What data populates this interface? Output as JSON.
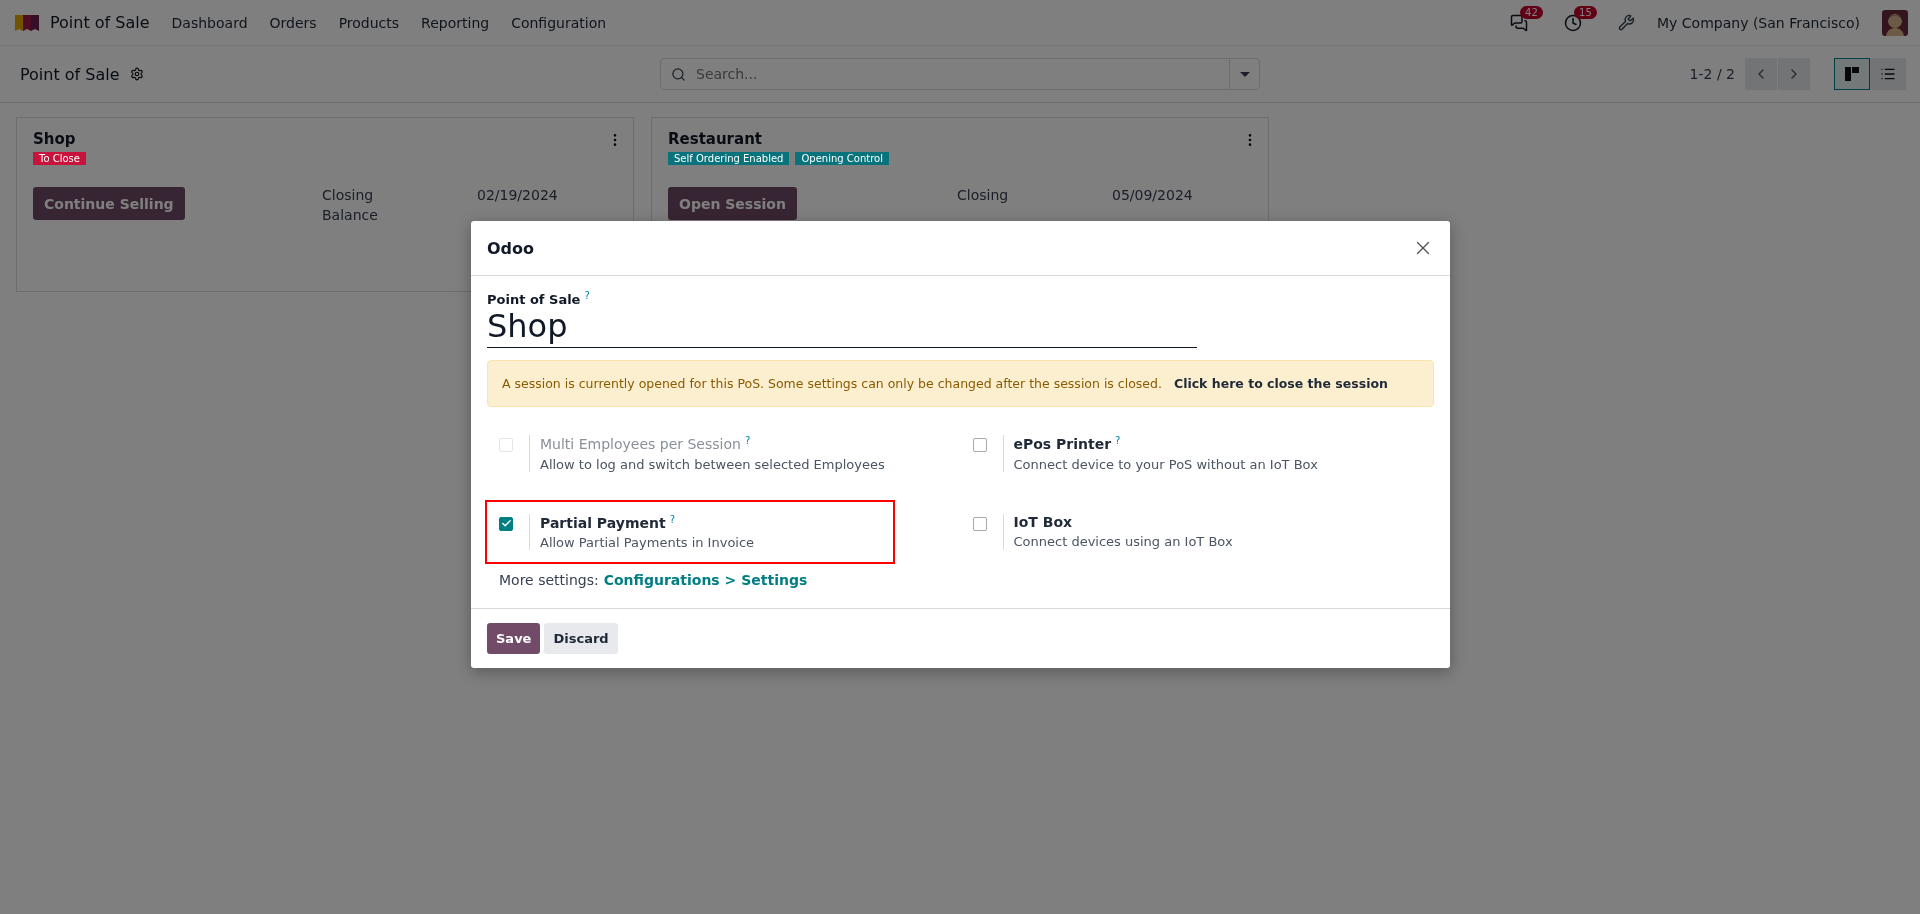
{
  "navbar": {
    "app_name": "Point of Sale",
    "menu": [
      "Dashboard",
      "Orders",
      "Products",
      "Reporting",
      "Configuration"
    ],
    "messages_count": "42",
    "activities_count": "15",
    "company": "My Company (San Francisco)"
  },
  "control_panel": {
    "title": "Point of Sale",
    "search": {
      "placeholder": "Search..."
    },
    "pager": "1-2 / 2",
    "views": [
      {
        "kind": "kanban",
        "selected": true
      },
      {
        "kind": "list",
        "selected": false
      }
    ]
  },
  "cards": [
    {
      "name": "Shop",
      "tags": [
        {
          "label": "To Close",
          "color": "#c8143c"
        }
      ],
      "button": "Continue Selling",
      "rows": [
        {
          "label": "Closing",
          "value": "02/19/2024"
        },
        {
          "label": "Balance",
          "value": ""
        }
      ]
    },
    {
      "name": "Restaurant",
      "tags": [
        {
          "label": "Self Ordering Enabled",
          "color": "#08737a"
        },
        {
          "label": "Opening Control",
          "color": "#08737a"
        }
      ],
      "button": "Open Session",
      "rows": [
        {
          "label": "Closing",
          "value": "05/09/2024"
        }
      ]
    }
  ],
  "dialog": {
    "title": "Odoo",
    "field_label": "Point of Sale",
    "field_help": "?",
    "field_value": "Shop",
    "alert": {
      "text": "A session is currently opened for this PoS. Some settings can only be changed after the session is closed.",
      "link": "Click here to close the session"
    },
    "settings": [
      {
        "title": "Multi Employees per Session",
        "help_mark": "?",
        "description": "Allow to log and switch between selected Employees",
        "checked": false,
        "disabled": true,
        "highlighted": false
      },
      {
        "title": "ePos Printer",
        "help_mark": "?",
        "description": "Connect device to your PoS without an IoT Box",
        "checked": false,
        "disabled": false,
        "highlighted": false
      },
      {
        "title": "Partial Payment",
        "help_mark": "?",
        "description": "Allow Partial Payments in Invoice",
        "checked": true,
        "disabled": false,
        "highlighted": true
      },
      {
        "title": "IoT Box",
        "description": "Connect devices using an IoT Box",
        "checked": false,
        "disabled": false,
        "highlighted": false
      }
    ],
    "more_settings_label": "More settings:",
    "more_settings_link": "Configurations > Settings",
    "buttons": [
      {
        "label": "Save",
        "kind": "primary"
      },
      {
        "label": "Discard",
        "kind": "secondary"
      }
    ]
  }
}
